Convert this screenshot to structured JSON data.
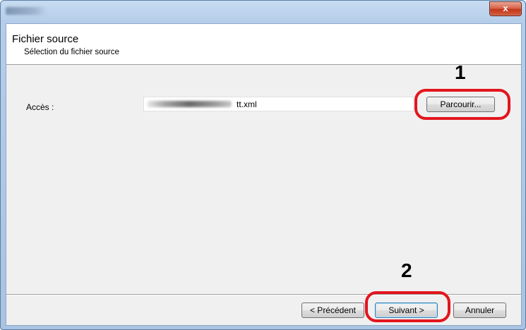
{
  "window": {
    "close_glyph": "x"
  },
  "header": {
    "title": "Fichier source",
    "subtitle": "Sélection du fichier source"
  },
  "form": {
    "path_label": "Accès :",
    "path_value_visible_suffix": "tt.xml",
    "browse_label": "Parcourir..."
  },
  "footer": {
    "back_label": "< Précédent",
    "next_label": "Suivant >",
    "cancel_label": "Annuler"
  },
  "annotations": {
    "step1": "1",
    "step2": "2"
  },
  "colors": {
    "annotation_ring": "#e3151d",
    "close_button": "#c2371c",
    "title_bar": "#b5cde9"
  }
}
